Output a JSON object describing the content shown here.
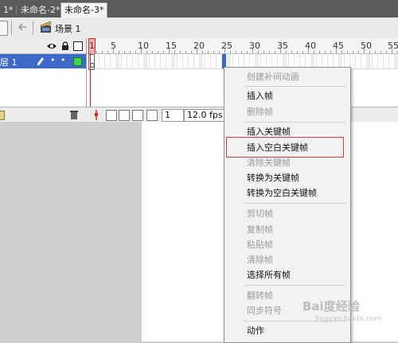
{
  "tabs": [
    {
      "label": "1*",
      "active": false
    },
    {
      "label": "未命名-2*",
      "active": false
    },
    {
      "label": "未命名-3*",
      "active": true
    }
  ],
  "editbar": {
    "scene_label": "场景 1"
  },
  "timeline": {
    "ruler_numbers": [
      "1",
      "5",
      "10",
      "15",
      "20",
      "25",
      "30",
      "35",
      "40",
      "45",
      "50",
      "55"
    ],
    "layer_name": "层 1",
    "current_frame": "1",
    "frame_rate": "12.0 fps"
  },
  "context_menu": {
    "items": [
      {
        "label": "创建补间动画",
        "enabled": false
      },
      {
        "label": "插入帧",
        "enabled": true
      },
      {
        "label": "删除帧",
        "enabled": false
      },
      {
        "label": "插入关键帧",
        "enabled": true
      },
      {
        "label": "插入空白关键帧",
        "enabled": true,
        "highlighted": true
      },
      {
        "label": "清除关键帧",
        "enabled": false
      },
      {
        "label": "转换为关键帧",
        "enabled": true
      },
      {
        "label": "转换为空白关键帧",
        "enabled": true
      },
      {
        "label": "剪切帧",
        "enabled": false
      },
      {
        "label": "复制帧",
        "enabled": false
      },
      {
        "label": "粘贴帧",
        "enabled": false
      },
      {
        "label": "清除帧",
        "enabled": false
      },
      {
        "label": "选择所有帧",
        "enabled": true
      },
      {
        "label": "翻转帧",
        "enabled": false
      },
      {
        "label": "同步符号",
        "enabled": false
      },
      {
        "label": "动作",
        "enabled": true
      }
    ]
  },
  "watermark": {
    "text": "Bai度经验",
    "sub": "jingyan.baidu.com"
  },
  "colors": {
    "layer_selected": "#3c69c8",
    "highlight_border": "#d43a3a",
    "playhead": "#e01818"
  }
}
